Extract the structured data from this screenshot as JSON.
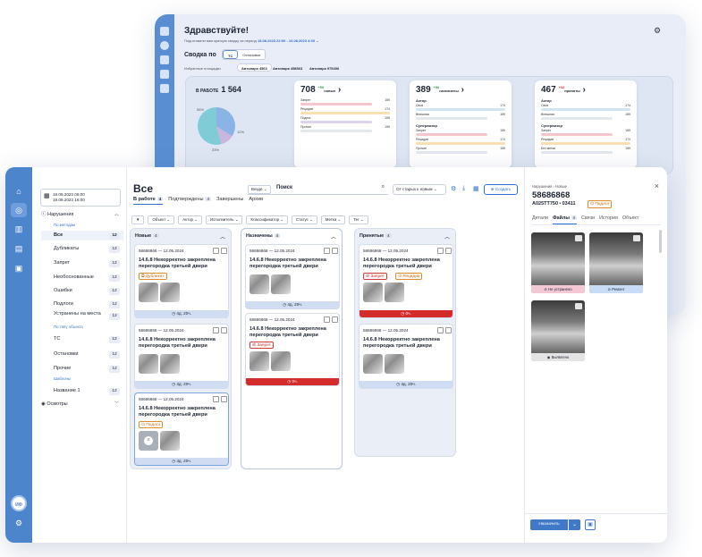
{
  "dashboard": {
    "greeting": "Здравствуйте!",
    "subtitle": "Подготовили вам краткую сводку за период",
    "period": "18.08.2023 22:00 - 19.08.2023 4:00",
    "summary_label": "Сводка по",
    "segments": [
      "ТС",
      "Остановки"
    ],
    "favorites_label": "Избранные площадки",
    "chips": [
      "Автопарк 4563",
      "Автопарк 458563",
      "Автопарк 975496"
    ],
    "work_label": "В РАБОТЕ",
    "work_value": "1 564",
    "pie_labels": [
      "33%",
      "12%",
      "55%"
    ],
    "cards": [
      {
        "value": "708",
        "delta": "+56",
        "unit": "новых",
        "rows": [
          {
            "label": "Запрет",
            "value": "159"
          },
          {
            "label": "Рецидив",
            "value": "174"
          },
          {
            "label": "Подлог",
            "value": "159"
          },
          {
            "label": "Прочие",
            "value": "159"
          }
        ]
      },
      {
        "value": "389",
        "delta": "+56",
        "unit": "назначены",
        "sections": [
          {
            "head": "Актор",
            "rows": [
              {
                "label": "Своя",
                "value": "174"
              },
              {
                "label": "Внешняя",
                "value": "159"
              }
            ]
          },
          {
            "head": "Супервизор",
            "rows": [
              {
                "label": "Запрет",
                "value": "159"
              },
              {
                "label": "Рецидив",
                "value": "174"
              },
              {
                "label": "Прочие",
                "value": "159"
              }
            ]
          }
        ]
      },
      {
        "value": "467",
        "delta": "+32",
        "unit": "приняты",
        "sections": [
          {
            "head": "Актор",
            "rows": [
              {
                "label": "Своя",
                "value": "174"
              },
              {
                "label": "Внешняя",
                "value": "159"
              }
            ]
          },
          {
            "head": "Супервизор",
            "rows": [
              {
                "label": "Запрет",
                "value": "159"
              },
              {
                "label": "Рецидив",
                "value": "174"
              },
              {
                "label": "Без метки",
                "value": "159"
              }
            ]
          }
        ]
      }
    ]
  },
  "rail": {
    "avatar": "ИФ"
  },
  "sidebar": {
    "date_from": "18.08.2023 05:00",
    "date_to": "19.08.2023 16:00",
    "group_violations": "Нарушения",
    "by_method": "По методам",
    "items": [
      {
        "label": "Все",
        "count": "12"
      },
      {
        "label": "Дубликаты",
        "count": "12"
      },
      {
        "label": "Запрет",
        "count": "12"
      },
      {
        "label": "Необоснованные",
        "count": "12"
      },
      {
        "label": "Ошибки",
        "count": "12"
      },
      {
        "label": "Подлоги",
        "count": "12"
      },
      {
        "label": "Устранены на места",
        "count": "12"
      }
    ],
    "by_object": "По типу объекта",
    "object_items": [
      {
        "label": "ТС",
        "count": "12"
      },
      {
        "label": "Остановки",
        "count": "12"
      },
      {
        "label": "Прочие",
        "count": "12"
      }
    ],
    "templates": "Шаблоны",
    "template_items": [
      {
        "label": "Название 1",
        "count": "12"
      }
    ],
    "group_inspections": "Осмотры"
  },
  "main": {
    "title": "Все",
    "tabs": [
      {
        "label": "В работе",
        "count": "4"
      },
      {
        "label": "Подтверждены",
        "count": "4"
      },
      {
        "label": "Завершены",
        "count": ""
      },
      {
        "label": "Архив",
        "count": ""
      }
    ],
    "search_scope": "Везде",
    "search_placeholder": "Поиск",
    "sort": "От старых к новым",
    "create": "Создать",
    "filters": [
      "Объект",
      "Актор",
      "Исполнитель",
      "Классификатор",
      "Статус",
      "Метка",
      "Тег"
    ],
    "columns": [
      {
        "title": "Новые",
        "count": "4"
      },
      {
        "title": "Назначены",
        "count": "4"
      },
      {
        "title": "Принятые",
        "count": "4"
      }
    ],
    "cards": [
      {
        "id": "58686868 — 12.05.2024",
        "title": "14.6.8 Некорректно закреплена перегородка третьей двери",
        "tag": "Дубликат",
        "footer": "4д. 20ч."
      },
      {
        "id": "58686868 — 12.05.2024",
        "title": "14.6.8 Некорректно закреплена перегородка третьей двери",
        "tag": "",
        "footer": "4д. 20ч."
      },
      {
        "id": "58686868 — 12.05.2024",
        "title": "14.6.8 Некорректно закреплена перегородка третьей двери",
        "tag": "Подлог",
        "footer": "4д. 20ч."
      },
      {
        "id": "58686868 — 12.05.2024",
        "title": "14.6.8 Некорректно закреплена перегородка третьей двери",
        "tag": "",
        "footer": "4д. 20ч."
      },
      {
        "id": "58686868 — 12.05.2024",
        "title": "14.6.8 Некорректно закреплена перегородка третьей двери",
        "tag": "Запрет",
        "footer": "0ч."
      },
      {
        "id": "58686868 — 12.05.2024",
        "title": "14.6.8 Некорректно закреплена перегородка третьей двери",
        "tag": "Запрет",
        "tag2": "Рецидив",
        "footer": "0ч."
      },
      {
        "id": "58686868 — 12.05.2024",
        "title": "14.6.8 Некорректно закреплена перегородка третьей двери",
        "tag": "",
        "footer": "4д. 20ч."
      }
    ]
  },
  "detail": {
    "crumb": "Нарушения › Новые",
    "id": "58686868",
    "plate_prefix": "А025ТТ750",
    "plate_suffix": "03411",
    "tag": "Подлог",
    "tabs": [
      {
        "label": "Детали",
        "count": ""
      },
      {
        "label": "Файлы",
        "count": "4"
      },
      {
        "label": "Связи",
        "count": ""
      },
      {
        "label": "История",
        "count": ""
      },
      {
        "label": "Объект",
        "count": ""
      }
    ],
    "photos": [
      "Не устранено",
      "Ремонт",
      "Выявлено"
    ],
    "assign": "Назначить"
  }
}
